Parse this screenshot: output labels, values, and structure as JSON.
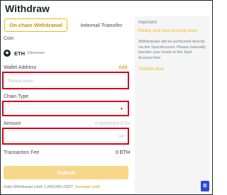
{
  "page": {
    "title": "Withdraw"
  },
  "tabs": [
    {
      "label": "On-chain Withdrawal",
      "active": true
    },
    {
      "label": "Internal Transfer",
      "active": false
    }
  ],
  "coin": {
    "label": "Coin",
    "icon": "ethereum-icon",
    "symbol": "ETH",
    "name": "Ethereum"
  },
  "wallet": {
    "label": "Wallet Address",
    "add_link": "Add",
    "placeholder": "Please enter"
  },
  "chain": {
    "label": "Chain Type",
    "value": ""
  },
  "amount": {
    "label": "Amount",
    "balance": "0.00000000 ETH",
    "max": "All"
  },
  "fee": {
    "label": "Transaction Fee",
    "value": "0 ETH"
  },
  "submit": {
    "label": "Submit"
  },
  "limit": {
    "text": "Daily Withdrawal Limit: 1,000,000 USDT",
    "link": "Increase Limit"
  },
  "side": {
    "title": "Important:",
    "help_link": "Please click here to know more",
    "notice": "Withdrawals will be performed directly via the Spot Account. Please manually transfer your funds to the Spot Account first.",
    "transfer_link": "Transfer Now"
  },
  "colors": {
    "accent": "#f0b90b",
    "accent_text": "#c99400",
    "highlight_border": "#d0021b",
    "submit_bg": "#f6d78a"
  }
}
